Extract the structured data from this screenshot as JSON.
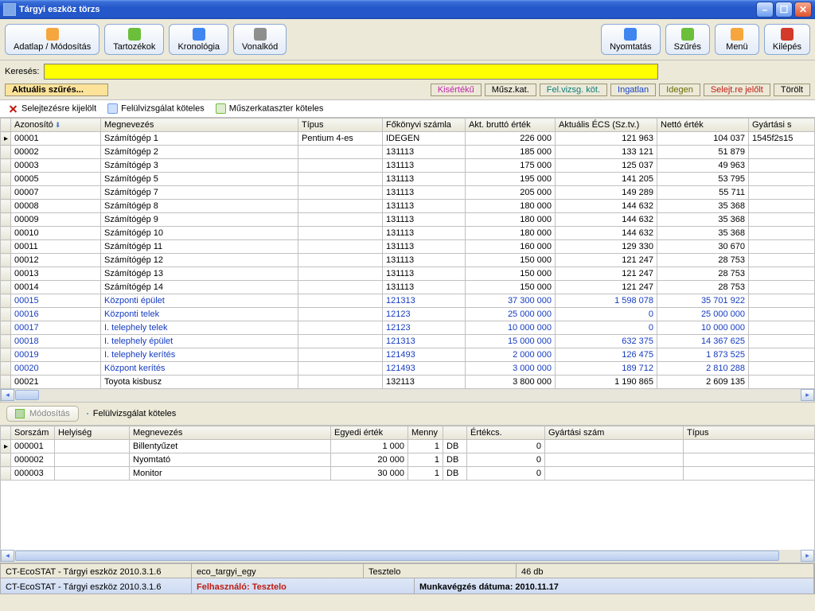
{
  "window": {
    "title": "Tárgyi eszköz törzs"
  },
  "toolbar": {
    "adatlap": "Adatlap / Módosítás",
    "tartozekok": "Tartozékok",
    "kronologia": "Kronológia",
    "vonalkod": "Vonalkód",
    "nyomtatas": "Nyomtatás",
    "szures": "Szűrés",
    "menu": "Menü",
    "kilepes": "Kilépés"
  },
  "search": {
    "label": "Keresés:",
    "value": ""
  },
  "filter": {
    "current": "Aktuális szűrés...",
    "chips": [
      {
        "label": "Kisértékű",
        "cls": "c-magenta"
      },
      {
        "label": "Műsz.kat.",
        "cls": ""
      },
      {
        "label": "Fel.vizsg. köt.",
        "cls": "c-teal"
      },
      {
        "label": "Ingatlan",
        "cls": "c-blue"
      },
      {
        "label": "Idegen",
        "cls": "c-olive"
      },
      {
        "label": "Selejt.re jelőlt",
        "cls": "c-red"
      },
      {
        "label": "Törölt",
        "cls": ""
      }
    ]
  },
  "legend": {
    "a": "Selejtezésre kijelölt",
    "b": "Felülvizsgálat köteles",
    "c": "Műszerkataszter köteles"
  },
  "grid": {
    "cols": [
      "Azonosító",
      "Megnevezés",
      "Típus",
      "Főkönyvi számla",
      "Akt. bruttó érték",
      "Aktuális ÉCS (Sz.tv.)",
      "Nettó érték",
      "Gyártási s"
    ],
    "rows": [
      {
        "id": "00001",
        "name": "Számítógép 1",
        "tip": "Pentium 4-es",
        "fk": "IDEGEN",
        "brutto": "226 000",
        "ecs": "121 963",
        "netto": "104 037",
        "gy": "1545f2s15",
        "blue": false,
        "sel": true
      },
      {
        "id": "00002",
        "name": "Számítógép 2",
        "tip": "",
        "fk": "131113",
        "brutto": "185 000",
        "ecs": "133 121",
        "netto": "51 879",
        "gy": "",
        "blue": false
      },
      {
        "id": "00003",
        "name": "Számítógép 3",
        "tip": "",
        "fk": "131113",
        "brutto": "175 000",
        "ecs": "125 037",
        "netto": "49 963",
        "gy": "",
        "blue": false
      },
      {
        "id": "00005",
        "name": "Számítógép 5",
        "tip": "",
        "fk": "131113",
        "brutto": "195 000",
        "ecs": "141 205",
        "netto": "53 795",
        "gy": "",
        "blue": false
      },
      {
        "id": "00007",
        "name": "Számítógép 7",
        "tip": "",
        "fk": "131113",
        "brutto": "205 000",
        "ecs": "149 289",
        "netto": "55 711",
        "gy": "",
        "blue": false
      },
      {
        "id": "00008",
        "name": "Számítógép 8",
        "tip": "",
        "fk": "131113",
        "brutto": "180 000",
        "ecs": "144 632",
        "netto": "35 368",
        "gy": "",
        "blue": false
      },
      {
        "id": "00009",
        "name": "Számítógép 9",
        "tip": "",
        "fk": "131113",
        "brutto": "180 000",
        "ecs": "144 632",
        "netto": "35 368",
        "gy": "",
        "blue": false
      },
      {
        "id": "00010",
        "name": "Számítógép 10",
        "tip": "",
        "fk": "131113",
        "brutto": "180 000",
        "ecs": "144 632",
        "netto": "35 368",
        "gy": "",
        "blue": false
      },
      {
        "id": "00011",
        "name": "Számítógép 11",
        "tip": "",
        "fk": "131113",
        "brutto": "160 000",
        "ecs": "129 330",
        "netto": "30 670",
        "gy": "",
        "blue": false
      },
      {
        "id": "00012",
        "name": "Számítógép 12",
        "tip": "",
        "fk": "131113",
        "brutto": "150 000",
        "ecs": "121 247",
        "netto": "28 753",
        "gy": "",
        "blue": false
      },
      {
        "id": "00013",
        "name": "Számítógép 13",
        "tip": "",
        "fk": "131113",
        "brutto": "150 000",
        "ecs": "121 247",
        "netto": "28 753",
        "gy": "",
        "blue": false
      },
      {
        "id": "00014",
        "name": "Számítógép 14",
        "tip": "",
        "fk": "131113",
        "brutto": "150 000",
        "ecs": "121 247",
        "netto": "28 753",
        "gy": "",
        "blue": false
      },
      {
        "id": "00015",
        "name": "Központi épület",
        "tip": "",
        "fk": "121313",
        "brutto": "37 300 000",
        "ecs": "1 598 078",
        "netto": "35 701 922",
        "gy": "",
        "blue": true
      },
      {
        "id": "00016",
        "name": "Központi telek",
        "tip": "",
        "fk": "12123",
        "brutto": "25 000 000",
        "ecs": "0",
        "netto": "25 000 000",
        "gy": "",
        "blue": true
      },
      {
        "id": "00017",
        "name": "I. telephely telek",
        "tip": "",
        "fk": "12123",
        "brutto": "10 000 000",
        "ecs": "0",
        "netto": "10 000 000",
        "gy": "",
        "blue": true
      },
      {
        "id": "00018",
        "name": "I. telephely épület",
        "tip": "",
        "fk": "121313",
        "brutto": "15 000 000",
        "ecs": "632 375",
        "netto": "14 367 625",
        "gy": "",
        "blue": true
      },
      {
        "id": "00019",
        "name": "I. telephely kerítés",
        "tip": "",
        "fk": "121493",
        "brutto": "2 000 000",
        "ecs": "126 475",
        "netto": "1 873 525",
        "gy": "",
        "blue": true
      },
      {
        "id": "00020",
        "name": "Központ kerítés",
        "tip": "",
        "fk": "121493",
        "brutto": "3 000 000",
        "ecs": "189 712",
        "netto": "2 810 288",
        "gy": "",
        "blue": true
      },
      {
        "id": "00021",
        "name": "Toyota kisbusz",
        "tip": "",
        "fk": "132113",
        "brutto": "3 800 000",
        "ecs": "1 190 865",
        "netto": "2 609 135",
        "gy": "",
        "blue": false
      }
    ]
  },
  "sub": {
    "modify": "Módosítás",
    "fv": "Felülvizsgálat köteles",
    "cols": [
      "Sorszám",
      "Helyiség",
      "Megnevezés",
      "Egyedi érték",
      "Menny",
      "",
      "Értékcs.",
      "Gyártási szám",
      "Típus"
    ],
    "rows": [
      {
        "ssz": "000001",
        "hely": "",
        "name": "Billentyűzet",
        "egyedi": "1 000",
        "menny": "1",
        "me": "DB",
        "ecs": "0",
        "gy": "",
        "tip": "",
        "sel": true
      },
      {
        "ssz": "000002",
        "hely": "",
        "name": "Nyomtató",
        "egyedi": "20 000",
        "menny": "1",
        "me": "DB",
        "ecs": "0",
        "gy": "",
        "tip": ""
      },
      {
        "ssz": "000003",
        "hely": "",
        "name": "Monitor",
        "egyedi": "30 000",
        "menny": "1",
        "me": "DB",
        "ecs": "0",
        "gy": "",
        "tip": ""
      }
    ]
  },
  "status": {
    "app": "CT-EcoSTAT - Tárgyi eszköz 2010.3.1.6",
    "db": "eco_targyi_egy",
    "user": "Tesztelo",
    "count": "46 db",
    "userlabel": "Felhasználó: ",
    "datelabel": "Munkavégzés dátuma: ",
    "date": "2010.11.17"
  }
}
